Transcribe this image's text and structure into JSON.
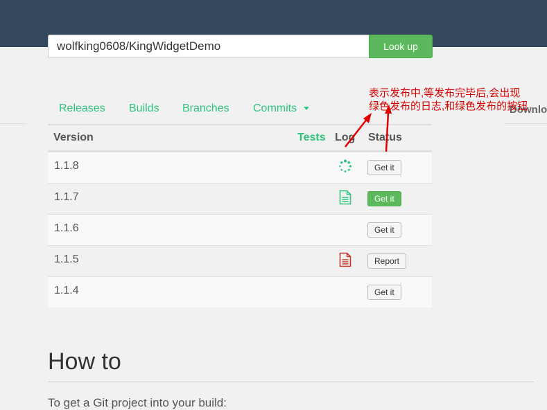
{
  "search": {
    "value": "wolfking0608/KingWidgetDemo",
    "button_label": "Look up"
  },
  "tabs": [
    {
      "label": "Releases"
    },
    {
      "label": "Builds"
    },
    {
      "label": "Branches"
    },
    {
      "label": "Commits"
    }
  ],
  "right_stub": "Downlo",
  "table": {
    "headers": {
      "version": "Version",
      "tests": "Tests",
      "log": "Log",
      "status": "Status"
    },
    "rows": [
      {
        "version": "1.1.8",
        "log": "spinner-icon",
        "status": "Get it",
        "status_style": "default"
      },
      {
        "version": "1.1.7",
        "log": "green-document-icon",
        "status": "Get it",
        "status_style": "success"
      },
      {
        "version": "1.1.6",
        "log": "",
        "status": "Get it",
        "status_style": "default"
      },
      {
        "version": "1.1.5",
        "log": "red-document-icon",
        "status": "Report",
        "status_style": "default"
      },
      {
        "version": "1.1.4",
        "log": "",
        "status": "Get it",
        "status_style": "default"
      }
    ]
  },
  "howto": {
    "title": "How to",
    "cut_text": "To get a Git project into your build:"
  },
  "annotation": {
    "line1": "表示发布中,等发布完毕后,会出现",
    "line2": "绿色发布的日志,和绿色发布的按钮",
    "color": "#d40000"
  },
  "colors": {
    "topbar": "#34495e",
    "accent_green": "#2ec47e",
    "button_green": "#5cb85c",
    "error_red": "#c0392b"
  }
}
